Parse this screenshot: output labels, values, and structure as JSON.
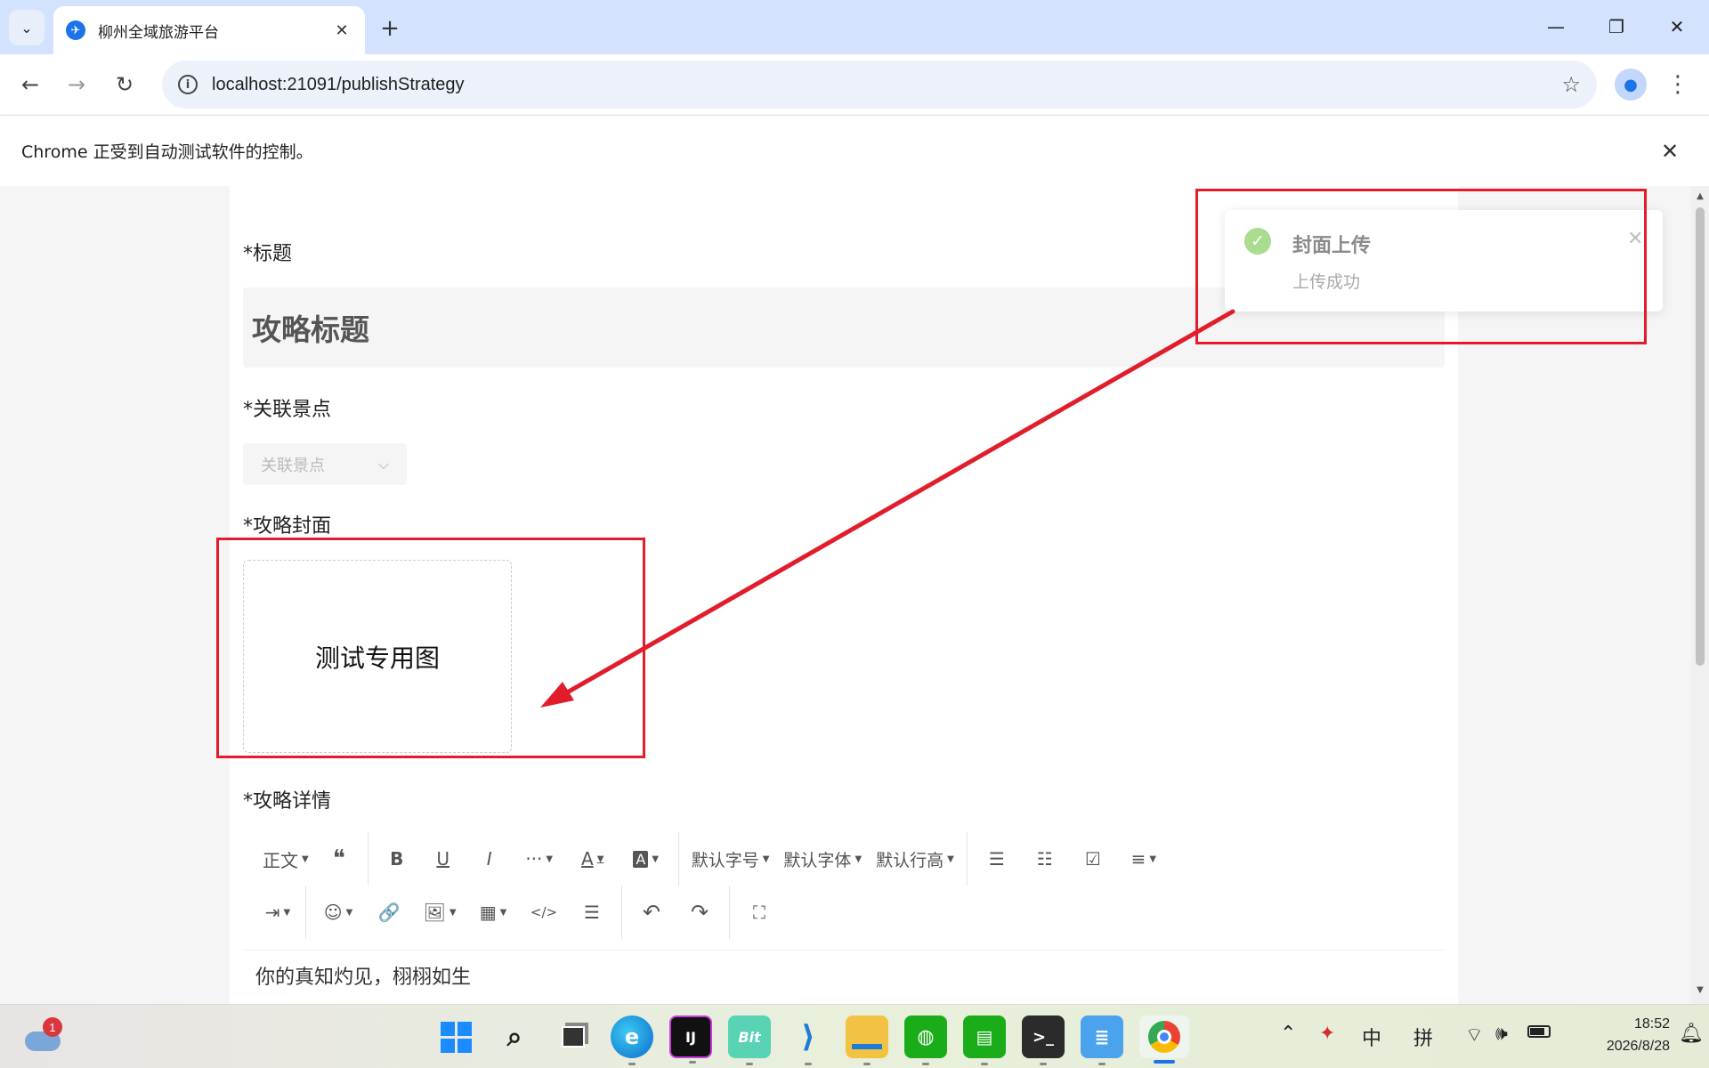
{
  "browser": {
    "tab_title": "柳州全域旅游平台",
    "tab_close": "✕",
    "new_tab": "+",
    "url": "localhost:21091/publishStrategy",
    "infobar_text": "Chrome 正受到自动测试软件的控制。",
    "infobar_close": "✕"
  },
  "form": {
    "title_label": "*标题",
    "title_value": "攻略标题",
    "spot_label": "*关联景点",
    "spot_placeholder": "关联景点",
    "cover_label": "*攻略封面",
    "cover_text": "测试专用图",
    "detail_label": "*攻略详情",
    "editor_content": "你的真知灼见，栩栩如生"
  },
  "editor_toolbar": {
    "row1": [
      "正文",
      "❝",
      "B",
      "U",
      "I",
      "···",
      "A",
      "A",
      "默认字号",
      "默认字体",
      "默认行高",
      "☰",
      "☷",
      "☑",
      "≡"
    ],
    "row2": [
      "⇥",
      "☺",
      "🔗",
      "🖼",
      "▦",
      "</>",
      "☰",
      "↶",
      "↷",
      "⛶"
    ]
  },
  "toast": {
    "title": "封面上传",
    "message": "上传成功",
    "icon": "✓",
    "close": "✕"
  },
  "taskbar": {
    "weather_badge": "1",
    "time": "18:52",
    "date": "2026/8/28",
    "ime_lang": "中",
    "ime_mode": "拼"
  },
  "colors": {
    "annotation_red": "#e11d2c",
    "success_green": "#a9dc8e",
    "tab_strip": "#d3e3fd"
  },
  "icons": [
    "tab-search-icon",
    "favicon-icon",
    "back-icon",
    "forward-icon",
    "reload-icon",
    "site-info-icon",
    "bookmark-star-icon",
    "profile-icon",
    "menu-icon",
    "success-check-icon",
    "close-icon",
    "chevron-down-icon"
  ]
}
